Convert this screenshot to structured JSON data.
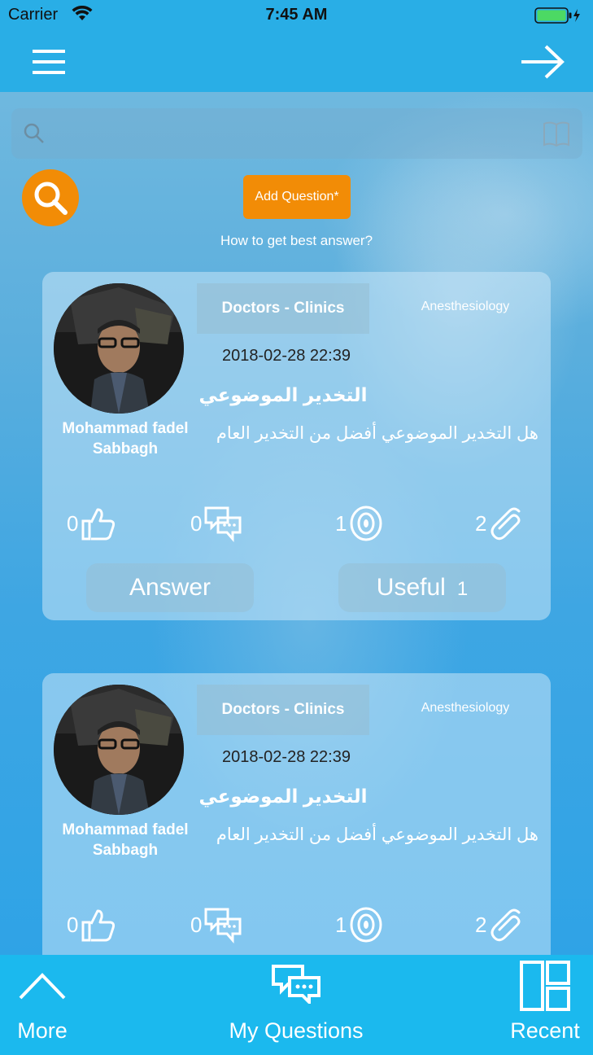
{
  "status_bar": {
    "carrier": "Carrier",
    "time": "7:45 AM"
  },
  "search": {
    "placeholder": ""
  },
  "actions": {
    "add_question": "Add Question*",
    "how_to": "How to get best answer?"
  },
  "questions": [
    {
      "author": "Mohammad fadel Sabbagh",
      "category": "Doctors - Clinics",
      "specialty": "Anesthesiology",
      "date": "2018-02-28 22:39",
      "title": "التخدير الموضوعي",
      "body": "هل التخدير الموضوعي أفضل من التخدير العام",
      "likes": "0",
      "comments": "0",
      "views": "1",
      "attachments": "2",
      "answer_label": "Answer",
      "useful_label": "Useful",
      "useful_count": "1"
    },
    {
      "author": "Mohammad fadel Sabbagh",
      "category": "Doctors - Clinics",
      "specialty": "Anesthesiology",
      "date": "2018-02-28 22:39",
      "title": "التخدير الموضوعي",
      "body": "هل التخدير الموضوعي أفضل من التخدير العام",
      "likes": "0",
      "comments": "0",
      "views": "1",
      "attachments": "2"
    }
  ],
  "tabs": [
    {
      "label": "More",
      "icon": "chevron-up-icon"
    },
    {
      "label": "My Questions",
      "icon": "chat-bubbles-icon"
    },
    {
      "label": "Recent",
      "icon": "layout-grid-icon"
    }
  ],
  "colors": {
    "accent": "#f28c06",
    "primary": "#29aee6",
    "tab_bar": "#1bb9ee"
  }
}
